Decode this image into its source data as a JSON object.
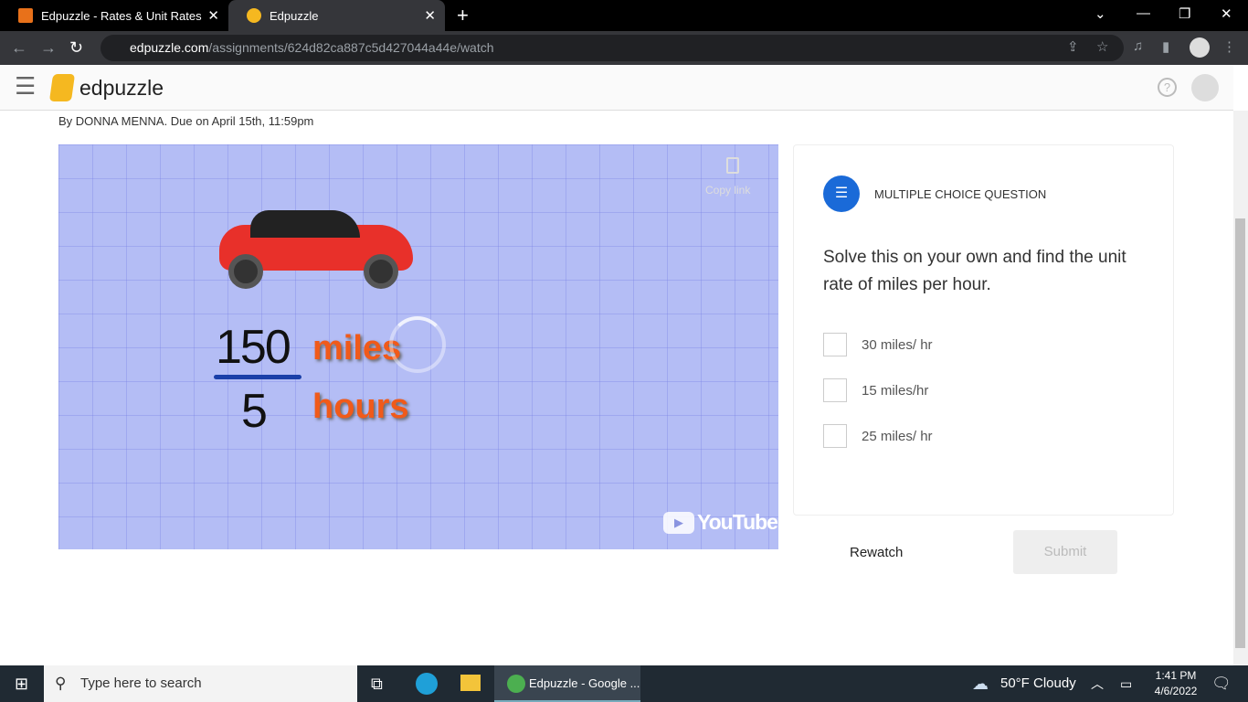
{
  "browser": {
    "tabs": [
      {
        "title": "Edpuzzle - Rates & Unit Rates"
      },
      {
        "title": "Edpuzzle"
      }
    ],
    "url_host": "edpuzzle.com",
    "url_path": "/assignments/624d82ca887c5d427044a44e/watch"
  },
  "app": {
    "logo": "edpuzzle",
    "byline": "By DONNA MENNA. Due on April 15th, 11:59pm"
  },
  "video": {
    "copy_link": "Copy link",
    "numerator": "150",
    "numerator_unit": "miles",
    "denominator": "5",
    "denominator_unit": "hours",
    "youtube": "YouTube"
  },
  "question": {
    "type": "MULTIPLE CHOICE QUESTION",
    "text": "Solve this on your own and find the unit rate of miles per hour.",
    "options": [
      "30 miles/ hr",
      "15 miles/hr",
      "25 miles/ hr"
    ],
    "accent": "#1a6ad8"
  },
  "actions": {
    "rewatch": "Rewatch",
    "submit": "Submit"
  },
  "taskbar": {
    "search_placeholder": "Type here to search",
    "app": "Edpuzzle - Google ...",
    "weather": "50°F  Cloudy",
    "time": "1:41 PM",
    "date": "4/6/2022"
  }
}
